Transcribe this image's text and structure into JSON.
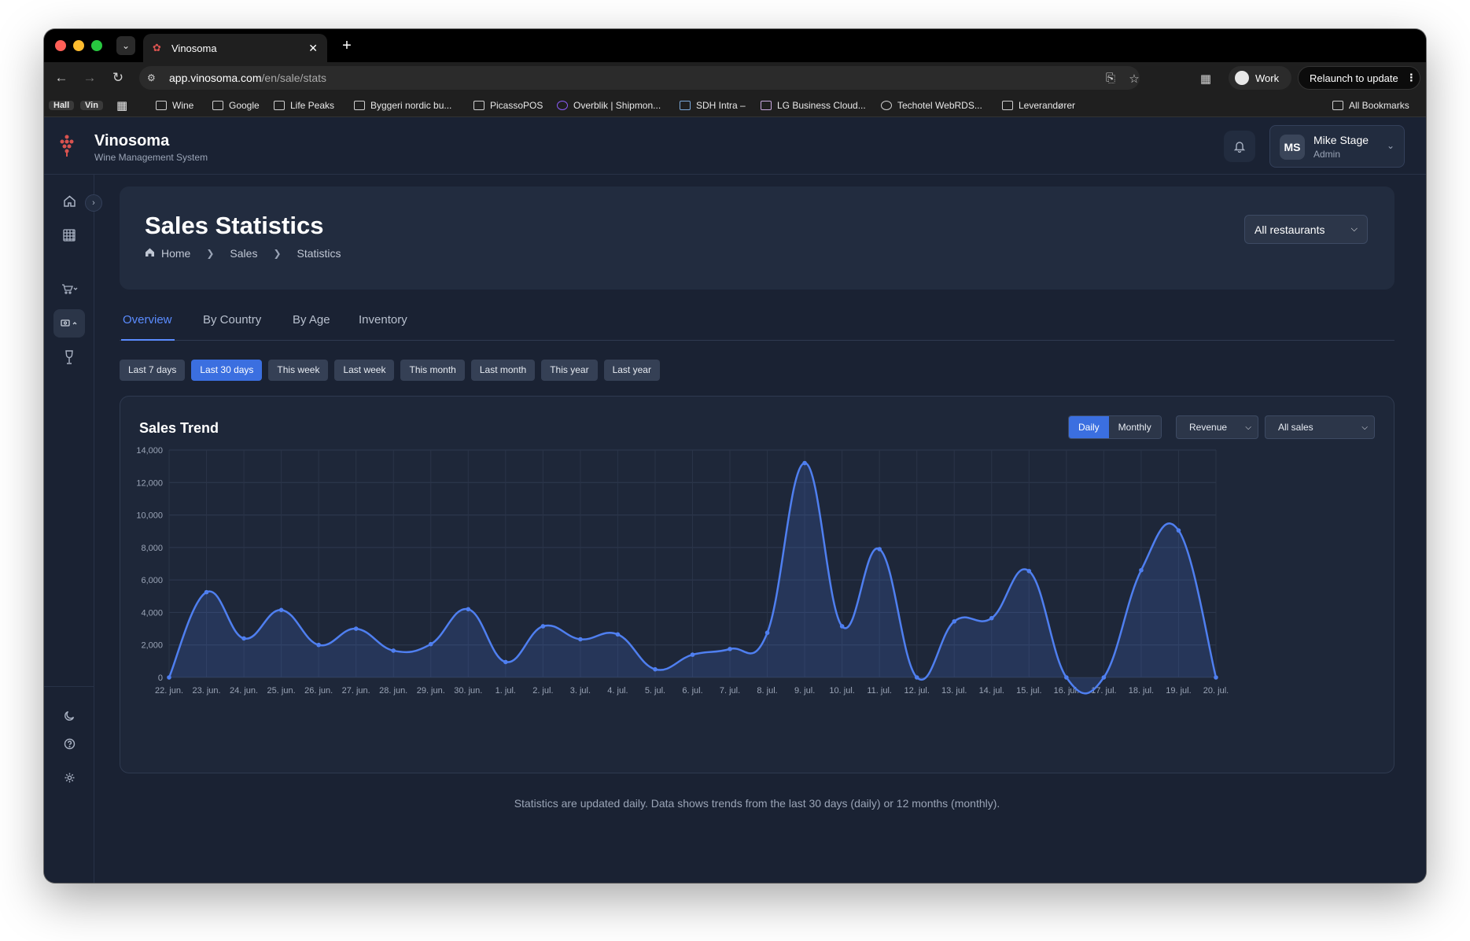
{
  "browser": {
    "tab_title": "Vinosoma",
    "url_host": "app.vinosoma.com",
    "url_path": "/en/sale/stats",
    "profile_label": "Work",
    "relaunch_label": "Relaunch to update",
    "bookmarks": [
      {
        "label": "Hall",
        "kind": "pill"
      },
      {
        "label": "Vin",
        "kind": "pill"
      },
      {
        "label": "Wine",
        "kind": "folder"
      },
      {
        "label": "Google",
        "kind": "folder"
      },
      {
        "label": "Life Peaks",
        "kind": "site"
      },
      {
        "label": "Byggeri nordic bu...",
        "kind": "folder"
      },
      {
        "label": "PicassoPOS",
        "kind": "site"
      },
      {
        "label": "Overblik | Shipmon...",
        "kind": "site"
      },
      {
        "label": "SDH Intra –",
        "kind": "site"
      },
      {
        "label": "LG Business Cloud...",
        "kind": "site"
      },
      {
        "label": "Techotel WebRDS...",
        "kind": "site"
      },
      {
        "label": "Leverandører",
        "kind": "folder"
      },
      {
        "label": "All Bookmarks",
        "kind": "folder"
      }
    ]
  },
  "app": {
    "brand_name": "Vinosoma",
    "brand_subtitle": "Wine Management System",
    "user": {
      "initials": "MS",
      "name": "Mike Stage",
      "role": "Admin"
    }
  },
  "page": {
    "title": "Sales Statistics",
    "breadcrumb": [
      "Home",
      "Sales",
      "Statistics"
    ],
    "restaurant_filter": "All restaurants",
    "tabs": [
      "Overview",
      "By Country",
      "By Age",
      "Inventory"
    ],
    "active_tab": "Overview",
    "ranges": [
      "Last 7 days",
      "Last 30 days",
      "This week",
      "Last week",
      "This month",
      "Last month",
      "This year",
      "Last year"
    ],
    "active_range": "Last 30 days",
    "chart_card": {
      "title": "Sales Trend",
      "granularity_options": [
        "Daily",
        "Monthly"
      ],
      "active_granularity": "Daily",
      "metric_select": "Revenue",
      "sales_type_select": "All sales"
    },
    "footnote": "Statistics are updated daily. Data shows trends from the last 30 days (daily) or 12 months (monthly)."
  },
  "colors": {
    "accent": "#3b6fe0",
    "line": "#4f7ff0",
    "background": "#1a2233"
  },
  "chart_data": {
    "type": "area",
    "title": "Sales Trend",
    "xlabel": "",
    "ylabel": "",
    "ylim": [
      0,
      14000
    ],
    "yticks": [
      0,
      2000,
      4000,
      6000,
      8000,
      10000,
      12000,
      14000
    ],
    "ytick_labels": [
      "0",
      "2,000",
      "4,000",
      "6,000",
      "8,000",
      "10,000",
      "12,000",
      "14,000"
    ],
    "grid": true,
    "categories": [
      "22. jun.",
      "23. jun.",
      "24. jun.",
      "25. jun.",
      "26. jun.",
      "27. jun.",
      "28. jun.",
      "29. jun.",
      "30. jun.",
      "1. jul.",
      "2. jul.",
      "3. jul.",
      "4. jul.",
      "5. jul.",
      "6. jul.",
      "7. jul.",
      "8. jul.",
      "9. jul.",
      "10. jul.",
      "11. jul.",
      "12. jul.",
      "13. jul.",
      "14. jul.",
      "15. jul.",
      "16. jul.",
      "17. jul.",
      "18. jul.",
      "19. jul.",
      "20. jul."
    ],
    "series": [
      {
        "values": [
          0,
          5250,
          2400,
          4150,
          2000,
          3000,
          1650,
          2050,
          4200,
          950,
          3150,
          2350,
          2650,
          500,
          1400,
          1750,
          2750,
          13200,
          3150,
          7900,
          0,
          3450,
          3650,
          6550,
          0,
          0,
          6600,
          9050,
          0
        ]
      }
    ]
  }
}
